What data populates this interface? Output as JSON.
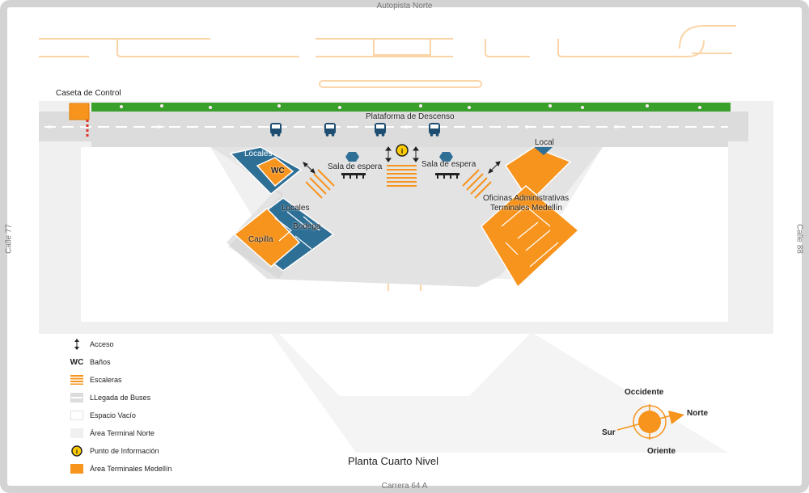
{
  "streets": {
    "top": "Autopista Norte",
    "bottom": "Carrera 64 A",
    "left": "Calle 77",
    "right": "Calle 88"
  },
  "labels": {
    "caseta": "Caseta de Control",
    "plataforma": "Plataforma de Descenso",
    "locales_top": "Locales",
    "wc": "WC",
    "locales_mid": "Locales",
    "bodega": "Bodega",
    "capilla": "Capilla",
    "sala_left": "Sala de espera",
    "sala_right": "Sala de espera",
    "local": "Local",
    "oficinas_line1": "Oficinas Administrativas",
    "oficinas_line2": "Terminales Medellín",
    "info_symbol": "i"
  },
  "floor_title": "Planta Cuarto Nivel",
  "legend": [
    {
      "symbol": "access-arrow",
      "label": "Acceso"
    },
    {
      "symbol": "wc-text",
      "symbol_text": "WC",
      "label": "Baños"
    },
    {
      "symbol": "stairs",
      "label": "Escaleras"
    },
    {
      "symbol": "bus-arrival",
      "label": "LLegada de Buses"
    },
    {
      "symbol": "empty-space",
      "label": "Espacio Vacío"
    },
    {
      "symbol": "north-terminal-area",
      "label": "Área Terminal Norte"
    },
    {
      "symbol": "info-point",
      "symbol_text": "i",
      "label": "Punto de Información"
    },
    {
      "symbol": "medellin-area",
      "label": "Área Terminales Medellín"
    }
  ],
  "compass": {
    "occidente": "Occidente",
    "norte": "Norte",
    "sur": "Sur",
    "oriente": "Oriente"
  },
  "colors": {
    "orange": "#f7941d",
    "blue": "#2e6f96",
    "grey_area": "#f0f0f0",
    "road": "#dcdcdc",
    "grass": "#3aa02c",
    "ghost_orange": "#fbd5a8"
  }
}
